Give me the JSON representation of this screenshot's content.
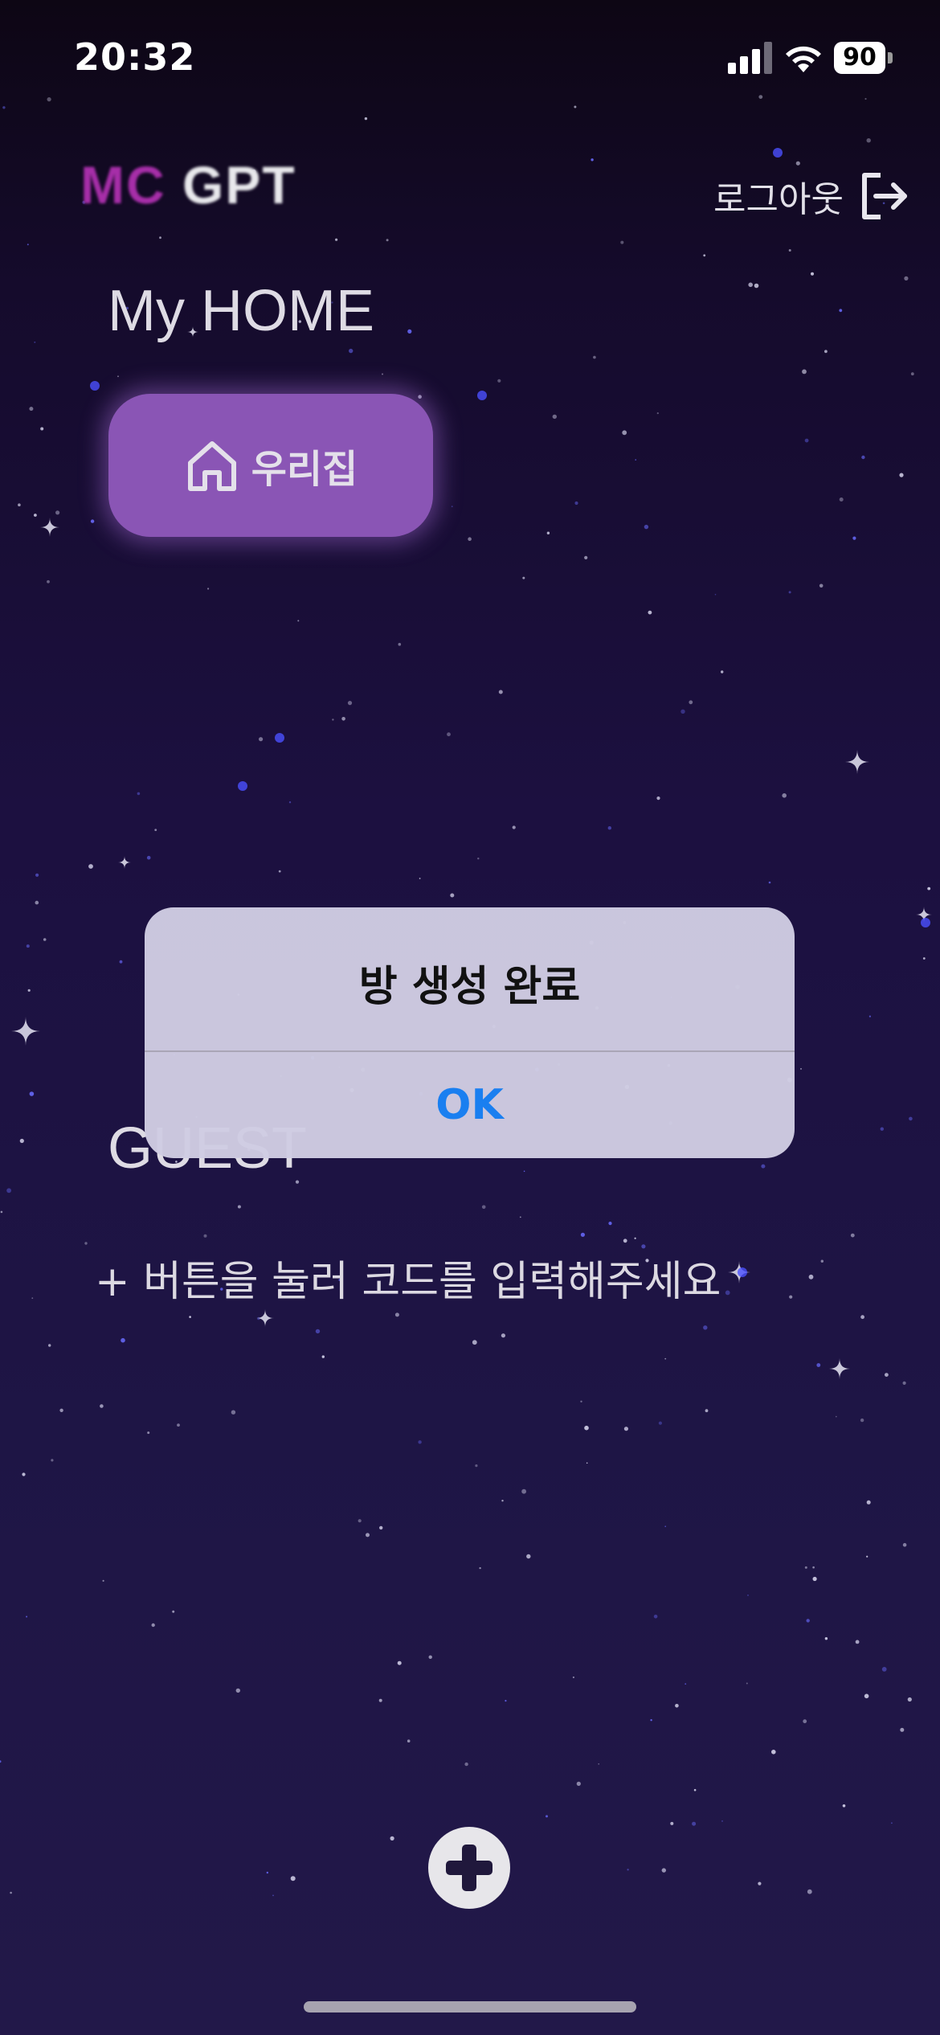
{
  "status_bar": {
    "time": "20:32",
    "battery": "90",
    "icons": [
      "cellular-signal-icon",
      "wifi-icon",
      "battery-icon"
    ]
  },
  "header": {
    "logo_mc": "MC",
    "logo_gpt": "GPT",
    "logout_label": "로그아웃",
    "logout_icon": "logout-arrow-icon"
  },
  "home": {
    "title": "My HOME",
    "rooms": [
      {
        "label": "우리집",
        "icon": "house-icon"
      }
    ]
  },
  "guest": {
    "title": "GUEST",
    "hint": "+ 버튼을 눌러 코드를 입력해주세요"
  },
  "alert": {
    "title": "방 생성 완료",
    "ok_label": "OK"
  },
  "add_button": {
    "icon": "plus-icon"
  },
  "colors": {
    "accent_purple": "#8a55b5",
    "logo_magenta": "#a62ea8",
    "alert_link_blue": "#1a7ff0",
    "background_top": "#0d0614",
    "background_bottom": "#221849"
  }
}
